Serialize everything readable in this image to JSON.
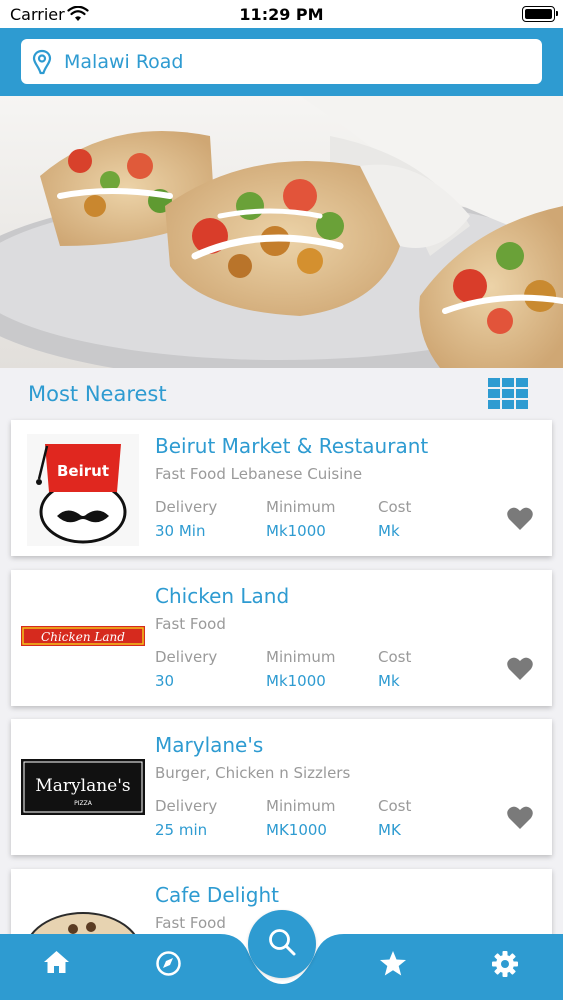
{
  "status_bar": {
    "carrier": "Carrier",
    "time": "11:29 PM"
  },
  "location": {
    "name": "Malawi Road"
  },
  "section": {
    "title": "Most Nearest"
  },
  "restaurants": [
    {
      "name": "Beirut Market & Restaurant",
      "cuisine": "Fast Food Lebanese Cuisine",
      "logo_text": "Beirut",
      "delivery_label": "Delivery",
      "delivery_value": "30 Min",
      "minimum_label": "Minimum",
      "minimum_value": "Mk1000",
      "cost_label": "Cost",
      "cost_value": "Mk"
    },
    {
      "name": "Chicken Land",
      "cuisine": "Fast Food",
      "logo_text": "Chicken Land",
      "delivery_label": "Delivery",
      "delivery_value": "30",
      "minimum_label": "Minimum",
      "minimum_value": "Mk1000",
      "cost_label": "Cost",
      "cost_value": "Mk"
    },
    {
      "name": "Marylane's",
      "cuisine": "Burger, Chicken n Sizzlers",
      "logo_text": "Marylane's",
      "logo_subtext": "PIZZA",
      "delivery_label": "Delivery",
      "delivery_value": "25 min",
      "minimum_label": "Minimum",
      "minimum_value": "MK1000",
      "cost_label": "Cost",
      "cost_value": "MK"
    },
    {
      "name": "Cafe Delight",
      "cuisine": "Fast Food"
    }
  ],
  "icons": {
    "location": "location-pin-icon",
    "grid": "grid-view-icon",
    "favorite": "heart-icon",
    "home": "home-icon",
    "explore": "compass-icon",
    "search": "search-icon",
    "favorites": "star-icon",
    "settings": "gear-icon"
  },
  "colors": {
    "accent": "#2e9bd1",
    "background": "#f1f1f4",
    "muted_text": "#9a9a9a",
    "heart": "#7a7a7a"
  }
}
